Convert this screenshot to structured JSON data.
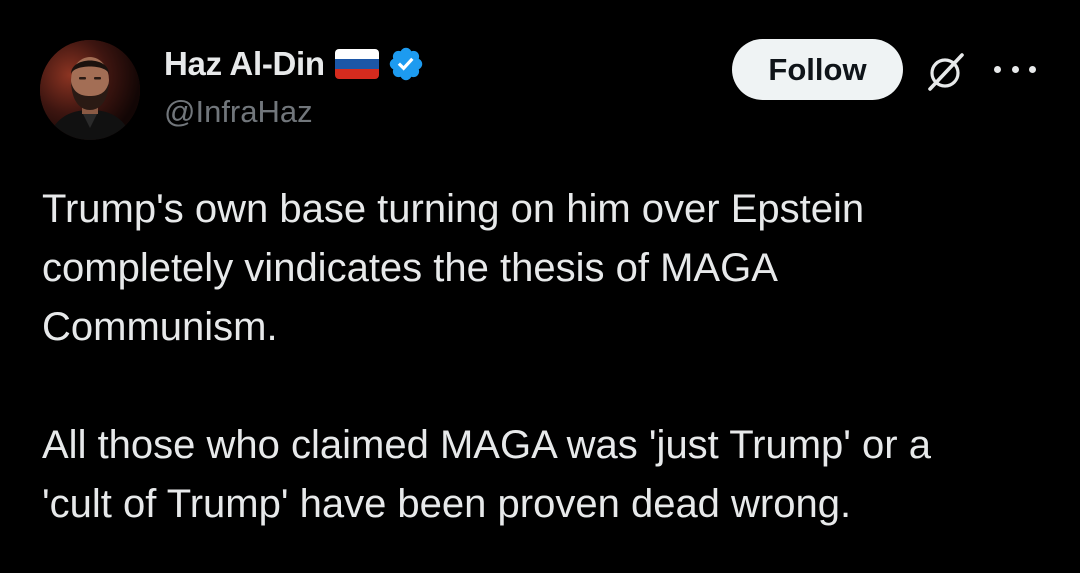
{
  "author": {
    "display_name": "Haz Al-Din",
    "handle": "@InfraHaz",
    "flag_icon": "russia-flag-icon",
    "flag_colors": [
      "#ffffff",
      "#1c57a7",
      "#d52b1e"
    ],
    "verified_icon": "verified-badge-icon",
    "verified_color": "#1d9bf0"
  },
  "actions": {
    "follow_label": "Follow",
    "grok_icon": "grok-icon",
    "more_icon": "more-options-icon"
  },
  "tweet": {
    "paragraphs": [
      "Trump's own base turning on him over Epstein\ncompletely vindicates the thesis of MAGA\nCommunism.",
      "All those who claimed MAGA was 'just Trump' or a\n'cult of Trump' have been proven dead wrong."
    ]
  },
  "colors": {
    "background": "#000000",
    "text_primary": "#e7e9ea",
    "text_secondary": "#71767b",
    "button_bg": "#eff3f4",
    "button_text": "#0f1419"
  }
}
